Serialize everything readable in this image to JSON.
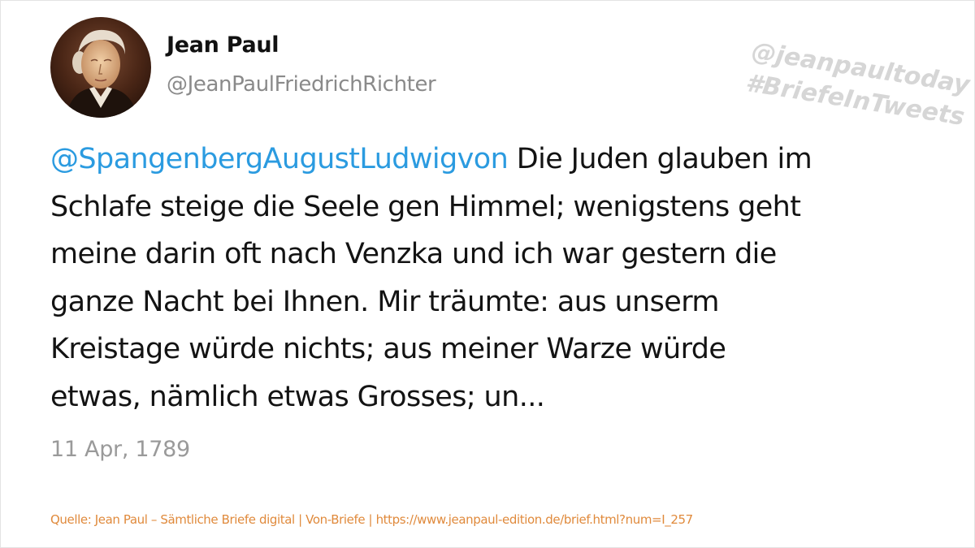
{
  "author": {
    "display_name": "Jean Paul",
    "handle": "@JeanPaulFriedrichRichter"
  },
  "watermark": {
    "line1": "@jeanpaultoday",
    "line2": "#BriefeInTweets"
  },
  "tweet": {
    "mention": "@SpangenbergAugustLudwigvon",
    "lines": [
      "Die Juden glauben im",
      "Schlafe steige die Seele gen Himmel; wenigstens geht",
      "meine darin oft nach Venzka und ich war gestern die",
      "ganze Nacht bei Ihnen. Mir träumte: aus unserm",
      "Kreistage würde nichts; aus meiner Warze würde",
      "etwas, nämlich etwas Grosses; un..."
    ],
    "date": "11 Apr, 1789"
  },
  "source": "Quelle: Jean Paul – Sämtliche Briefe digital | Von-Briefe | https://www.jeanpaul-edition.de/brief.html?num=I_257",
  "colors": {
    "mention": "#2b9be0",
    "text": "#131313",
    "muted": "#8a8a8a",
    "source": "#e08a3c",
    "watermark": "#d6d6d6"
  }
}
